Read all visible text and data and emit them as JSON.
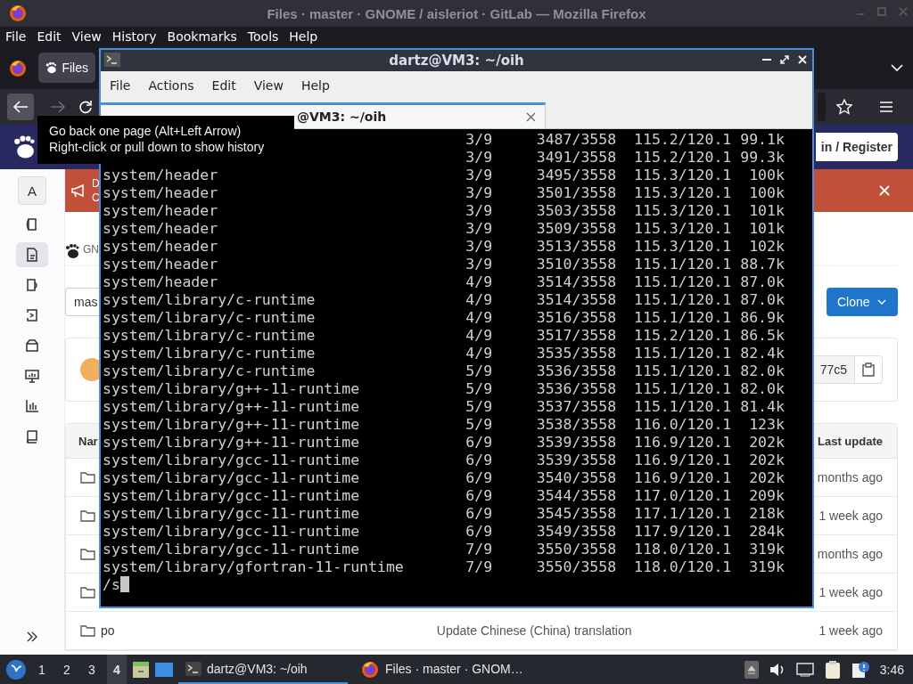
{
  "firefox": {
    "title": "Files · master · GNOME / aisleriot · GitLab — Mozilla Firefox",
    "menu": [
      "File",
      "Edit",
      "View",
      "History",
      "Bookmarks",
      "Tools",
      "Help"
    ],
    "tabs": [
      {
        "label": "Files",
        "selected": true
      }
    ],
    "nav": {
      "back_hovered": true,
      "forward_disabled": true
    }
  },
  "tooltip": {
    "lines": [
      "Go back one page (Alt+Left Arrow)",
      "Right-click or pull down to show history"
    ]
  },
  "gitlab": {
    "signin": "in / Register",
    "avatar": "A",
    "sidebar": [
      {
        "kind": "issues",
        "selected": false
      },
      {
        "kind": "file",
        "selected": true
      },
      {
        "kind": "cup",
        "selected": false
      },
      {
        "kind": "deploy",
        "selected": false
      },
      {
        "kind": "package",
        "selected": false
      },
      {
        "kind": "monitor",
        "selected": false
      },
      {
        "kind": "chart",
        "selected": false
      },
      {
        "kind": "book",
        "selected": false
      }
    ],
    "banner": {
      "lines": [
        "D",
        "C"
      ]
    },
    "breadcrumb": "GN",
    "branch": "mas",
    "clone": "Clone",
    "commit_sha": "77c5",
    "table": {
      "columns": [
        "Nar",
        "Last update"
      ],
      "rows": [
        {
          "updated": "months ago"
        },
        {
          "updated": "1 week ago"
        },
        {
          "updated": "months ago"
        },
        {
          "updated": "1 week ago"
        },
        {
          "name": "po",
          "message": "Update Chinese (China) translation",
          "updated": "1 week ago"
        }
      ]
    }
  },
  "terminal": {
    "title": "dartz@VM3: ~/oih",
    "menu": [
      "File",
      "Actions",
      "Edit",
      "View",
      "Help"
    ],
    "tabs": [
      {
        "label": "@VM3: ~/oih",
        "selected": true
      }
    ],
    "lines": [
      {
        "step": "3/9",
        "count": "3487/3558",
        "mem": "115.2/120.1",
        "size": "99.1k"
      },
      {
        "step": "3/9",
        "count": "3491/3558",
        "mem": "115.2/120.1",
        "size": "99.3k"
      },
      {
        "name": "system/header",
        "step": "3/9",
        "count": "3495/3558",
        "mem": "115.3/120.1",
        "size": "100k"
      },
      {
        "name": "system/header",
        "step": "3/9",
        "count": "3501/3558",
        "mem": "115.3/120.1",
        "size": "100k"
      },
      {
        "name": "system/header",
        "step": "3/9",
        "count": "3503/3558",
        "mem": "115.3/120.1",
        "size": "101k"
      },
      {
        "name": "system/header",
        "step": "3/9",
        "count": "3509/3558",
        "mem": "115.3/120.1",
        "size": "101k"
      },
      {
        "name": "system/header",
        "step": "3/9",
        "count": "3513/3558",
        "mem": "115.3/120.1",
        "size": "102k"
      },
      {
        "name": "system/header",
        "step": "3/9",
        "count": "3510/3558",
        "mem": "115.1/120.1",
        "size": "88.7k"
      },
      {
        "name": "system/header",
        "step": "4/9",
        "count": "3514/3558",
        "mem": "115.1/120.1",
        "size": "87.0k"
      },
      {
        "name": "system/library/c-runtime",
        "step": "4/9",
        "count": "3514/3558",
        "mem": "115.1/120.1",
        "size": "87.0k"
      },
      {
        "name": "system/library/c-runtime",
        "step": "4/9",
        "count": "3516/3558",
        "mem": "115.1/120.1",
        "size": "86.9k"
      },
      {
        "name": "system/library/c-runtime",
        "step": "4/9",
        "count": "3517/3558",
        "mem": "115.2/120.1",
        "size": "86.5k"
      },
      {
        "name": "system/library/c-runtime",
        "step": "4/9",
        "count": "3535/3558",
        "mem": "115.1/120.1",
        "size": "82.4k"
      },
      {
        "name": "system/library/c-runtime",
        "step": "5/9",
        "count": "3536/3558",
        "mem": "115.1/120.1",
        "size": "82.0k"
      },
      {
        "name": "system/library/g++-11-runtime",
        "step": "5/9",
        "count": "3536/3558",
        "mem": "115.1/120.1",
        "size": "82.0k"
      },
      {
        "name": "system/library/g++-11-runtime",
        "step": "5/9",
        "count": "3537/3558",
        "mem": "115.1/120.1",
        "size": "81.4k"
      },
      {
        "name": "system/library/g++-11-runtime",
        "step": "5/9",
        "count": "3538/3558",
        "mem": "116.0/120.1",
        "size": "123k"
      },
      {
        "name": "system/library/g++-11-runtime",
        "step": "6/9",
        "count": "3539/3558",
        "mem": "116.9/120.1",
        "size": "202k"
      },
      {
        "name": "system/library/gcc-11-runtime",
        "step": "6/9",
        "count": "3539/3558",
        "mem": "116.9/120.1",
        "size": "202k"
      },
      {
        "name": "system/library/gcc-11-runtime",
        "step": "6/9",
        "count": "3540/3558",
        "mem": "116.9/120.1",
        "size": "202k"
      },
      {
        "name": "system/library/gcc-11-runtime",
        "step": "6/9",
        "count": "3544/3558",
        "mem": "117.0/120.1",
        "size": "209k"
      },
      {
        "name": "system/library/gcc-11-runtime",
        "step": "6/9",
        "count": "3545/3558",
        "mem": "117.1/120.1",
        "size": "218k"
      },
      {
        "name": "system/library/gcc-11-runtime",
        "step": "6/9",
        "count": "3549/3558",
        "mem": "117.9/120.1",
        "size": "284k"
      },
      {
        "name": "system/library/gcc-11-runtime",
        "step": "7/9",
        "count": "3550/3558",
        "mem": "118.0/120.1",
        "size": "319k"
      },
      {
        "name": "system/library/gfortran-11-runtime",
        "step": "7/9",
        "count": "3550/3558",
        "mem": "118.0/120.1",
        "size": "319k"
      }
    ],
    "prompt": "/s"
  },
  "taskbar": {
    "workspaces": [
      {
        "label": "1",
        "selected": false
      },
      {
        "label": "2",
        "selected": false
      },
      {
        "label": "3",
        "selected": false
      },
      {
        "label": "4",
        "selected": true
      }
    ],
    "tasks": [
      {
        "kind": "terminal",
        "label": "dartz@VM3: ~/oih",
        "selected": true
      },
      {
        "kind": "firefox",
        "label": "Files · master · GNOM…",
        "selected": false
      }
    ],
    "clock": "3:46"
  }
}
